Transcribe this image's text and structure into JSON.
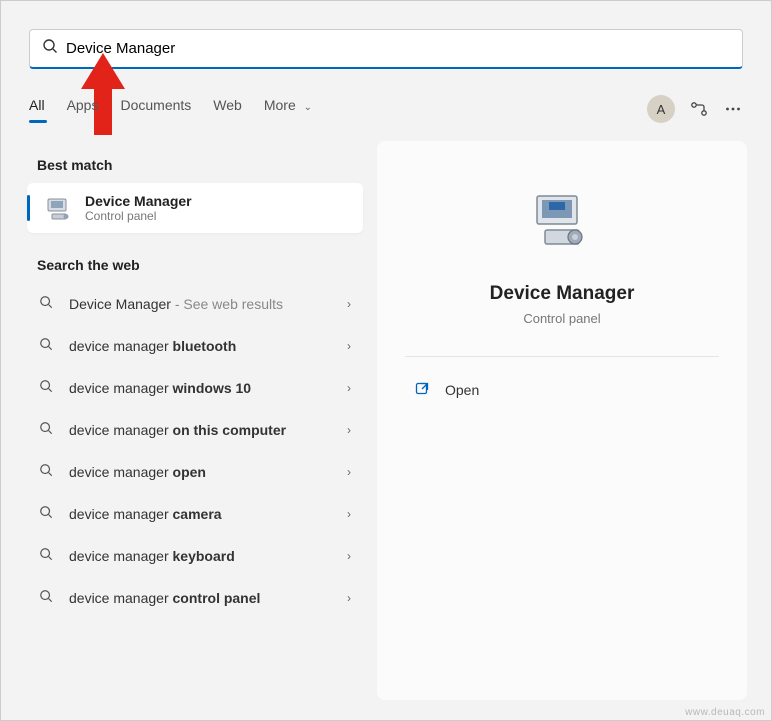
{
  "search": {
    "value": "Device Manager"
  },
  "tabs": {
    "all": "All",
    "apps": "Apps",
    "documents": "Documents",
    "web": "Web",
    "more": "More"
  },
  "avatar_letter": "A",
  "sections": {
    "best_match": "Best match",
    "search_web": "Search the web"
  },
  "best_match_result": {
    "title": "Device Manager",
    "subtitle": "Control panel"
  },
  "web_results": [
    {
      "prefix": "Device Manager",
      "bold": "",
      "suffix": " - See web results"
    },
    {
      "prefix": "device manager ",
      "bold": "bluetooth",
      "suffix": ""
    },
    {
      "prefix": "device manager ",
      "bold": "windows 10",
      "suffix": ""
    },
    {
      "prefix": "device manager ",
      "bold": "on this computer",
      "suffix": ""
    },
    {
      "prefix": "device manager ",
      "bold": "open",
      "suffix": ""
    },
    {
      "prefix": "device manager ",
      "bold": "camera",
      "suffix": ""
    },
    {
      "prefix": "device manager ",
      "bold": "keyboard",
      "suffix": ""
    },
    {
      "prefix": "device manager ",
      "bold": "control panel",
      "suffix": ""
    }
  ],
  "detail": {
    "title": "Device Manager",
    "subtitle": "Control panel",
    "open_label": "Open"
  },
  "watermark": "www.deuaq.com"
}
